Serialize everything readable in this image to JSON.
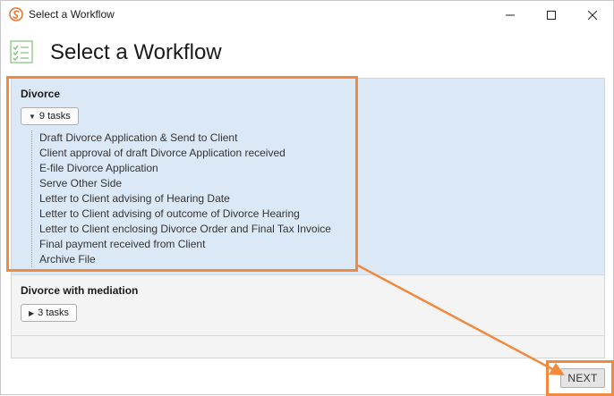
{
  "window": {
    "title": "Select a Workflow"
  },
  "header": {
    "title": "Select a Workflow"
  },
  "workflows": [
    {
      "name": "Divorce",
      "tasks_label": "9 tasks",
      "expanded": true,
      "selected": true,
      "tasks": [
        "Draft Divorce Application & Send to Client",
        "Client approval of draft Divorce Application received",
        "E-file Divorce Application",
        "Serve Other Side",
        "Letter to Client advising of Hearing Date",
        "Letter to Client advising of outcome of Divorce Hearing",
        "Letter to Client enclosing Divorce Order and Final Tax Invoice",
        "Final payment received from Client",
        "Archive File"
      ]
    },
    {
      "name": "Divorce with mediation",
      "tasks_label": "3 tasks",
      "expanded": false,
      "selected": false
    }
  ],
  "footer": {
    "next_label": "NEXT"
  },
  "colors": {
    "selected_bg": "#dbe9f7",
    "annotation": "#ef8a3e",
    "list_bg": "#f4f4f4"
  }
}
